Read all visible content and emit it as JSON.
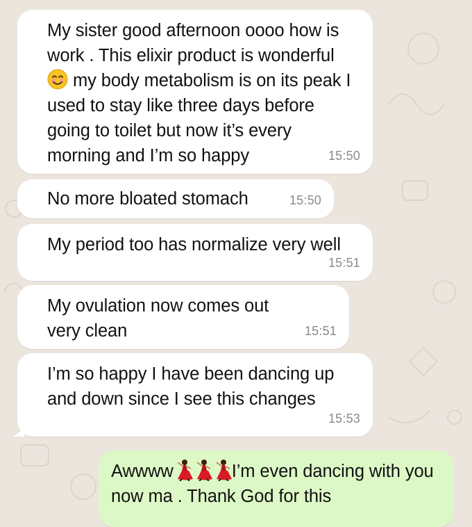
{
  "colors": {
    "chat_background": "#ebe5de",
    "incoming_bubble": "#ffffff",
    "outgoing_bubble": "#dcf8c6",
    "timestamp": "#8a8a8a"
  },
  "messages": [
    {
      "direction": "incoming",
      "text_part1": "My sister good afternoon oooo how is work . This elixir product is wonderful ",
      "emoji": "smiling-face-icon",
      "text_part2": " my body metabolism is on its peak I used to stay like three days before going to toilet but now it’s every morning and I’m so happy",
      "time": "15:50"
    },
    {
      "direction": "incoming",
      "text": "No more bloated stomach",
      "time": "15:50"
    },
    {
      "direction": "incoming",
      "text": "My period too has normalize very well",
      "time": "15:51"
    },
    {
      "direction": "incoming",
      "text": "My ovulation now comes out very clean",
      "time": "15:51"
    },
    {
      "direction": "incoming",
      "text": "I’m so happy I have been dancing up and down since I see this changes",
      "time": "15:53"
    },
    {
      "direction": "outgoing",
      "text_part1": "Awwww",
      "emoji": "dancing-woman-icon",
      "emoji_count": 3,
      "text_part2": "I’m even dancing with you now ma . Thank God for this"
    }
  ]
}
